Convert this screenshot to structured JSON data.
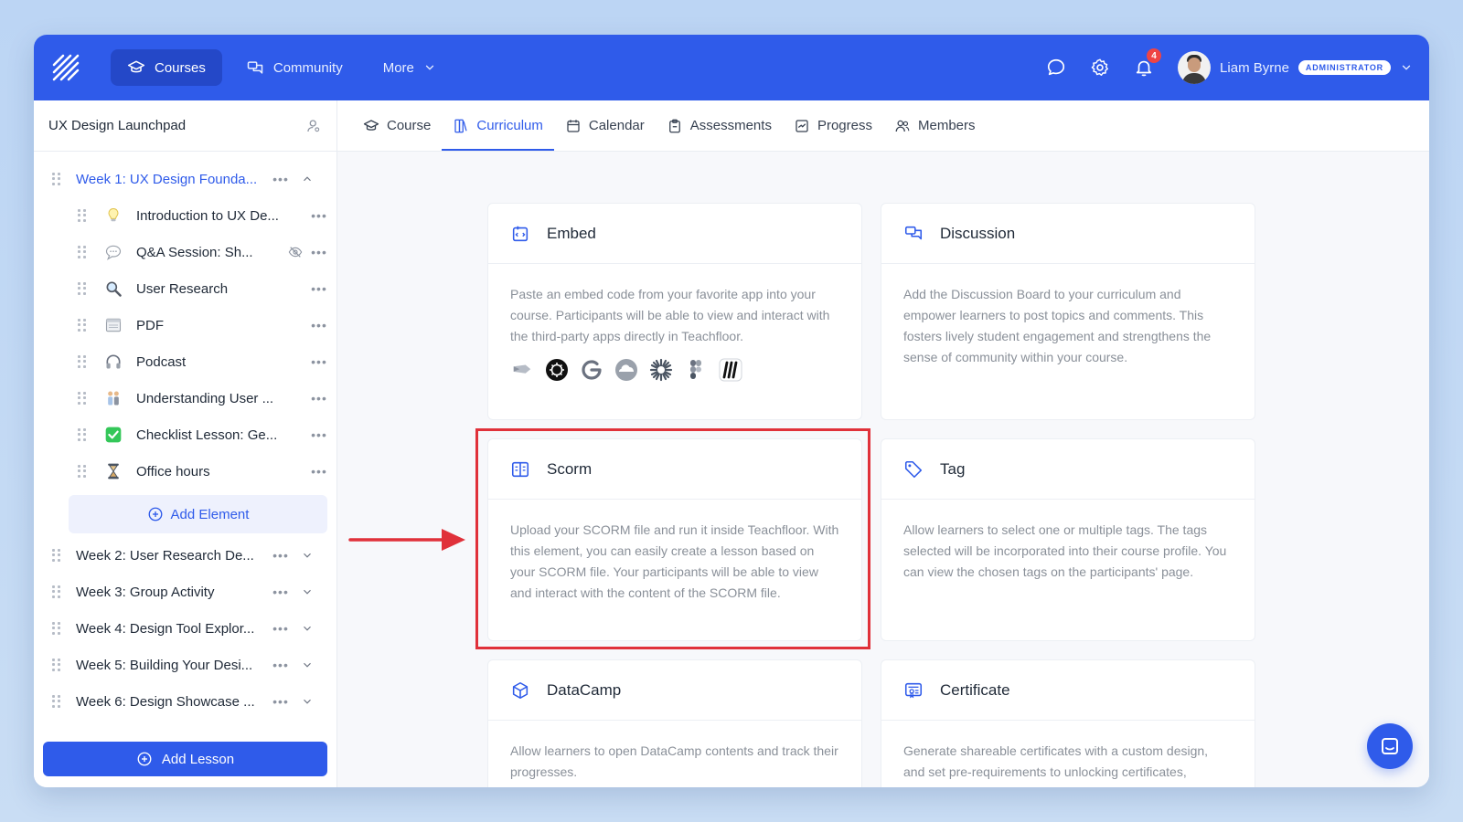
{
  "nav": {
    "courses": "Courses",
    "community": "Community",
    "more": "More",
    "notifications_count": "4",
    "user_name": "Liam Byrne",
    "role_badge": "ADMINISTRATOR"
  },
  "course": {
    "title": "UX Design Launchpad"
  },
  "tabs": [
    {
      "label": "Course",
      "icon": "graduation-cap-icon"
    },
    {
      "label": "Curriculum",
      "icon": "book-icon",
      "active": true
    },
    {
      "label": "Calendar",
      "icon": "calendar-icon"
    },
    {
      "label": "Assessments",
      "icon": "clipboard-icon"
    },
    {
      "label": "Progress",
      "icon": "progress-icon"
    },
    {
      "label": "Members",
      "icon": "members-icon"
    }
  ],
  "sidebar": {
    "weeks": [
      {
        "label": "Week 1: UX Design Founda...",
        "expanded": true
      },
      {
        "label": "Week 2: User Research De..."
      },
      {
        "label": "Week 3: Group Activity"
      },
      {
        "label": "Week 4: Design Tool Explor..."
      },
      {
        "label": "Week 5: Building Your Desi..."
      },
      {
        "label": "Week 6: Design Showcase ..."
      }
    ],
    "lessons": [
      {
        "label": "Introduction to UX De...",
        "icon": "lightbulb-icon"
      },
      {
        "label": "Q&A Session: Sh...",
        "icon": "speech-bubble-icon",
        "hidden": true
      },
      {
        "label": "User Research",
        "icon": "magnifier-icon"
      },
      {
        "label": "PDF",
        "icon": "document-icon"
      },
      {
        "label": "Podcast",
        "icon": "headphones-icon"
      },
      {
        "label": "Understanding User ...",
        "icon": "people-icon"
      },
      {
        "label": "Checklist Lesson: Ge...",
        "icon": "check-box-icon"
      },
      {
        "label": "Office hours",
        "icon": "hourglass-icon"
      }
    ],
    "add_element": "Add Element",
    "add_lesson": "Add Lesson"
  },
  "cards": {
    "embed": {
      "title": "Embed",
      "body": "Paste an embed code from your favorite app into your course. Participants will be able to view and interact with the third-party apps directly in Teachfloor."
    },
    "discussion": {
      "title": "Discussion",
      "body": "Add the Discussion Board to your curriculum and empower learners to post topics and comments. This fosters lively student engagement and strengthens the sense of community within your course."
    },
    "scorm": {
      "title": "Scorm",
      "body": "Upload your SCORM file and run it inside Teachfloor. With this element, you can easily create a lesson based on your SCORM file. Your participants will be able to view and interact with the content of the SCORM file."
    },
    "tag": {
      "title": "Tag",
      "body": "Allow learners to select one or multiple tags. The tags selected will be incorporated into their course profile. You can view the chosen tags on the participants' page."
    },
    "datacamp": {
      "title": "DataCamp",
      "body": "Allow learners to open DataCamp contents and track their progresses."
    },
    "certificate": {
      "title": "Certificate",
      "body": "Generate shareable certificates with a custom design, and set pre-requirements to unlocking certificates, ensuring learners meet specific pre-"
    }
  },
  "colors": {
    "brand": "#2f5bea",
    "highlight": "#e0313a"
  }
}
